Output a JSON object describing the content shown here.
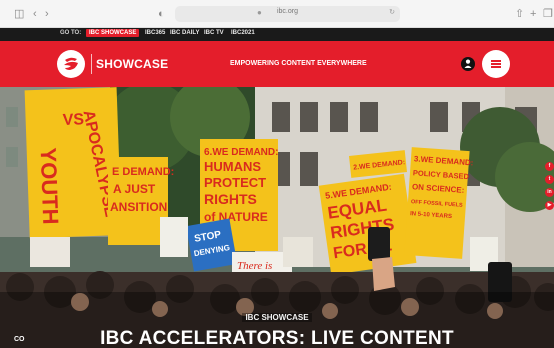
{
  "browser": {
    "url": "ibc.org"
  },
  "goto": {
    "label": "GO TO:",
    "links": [
      "IBC SHOWCASE",
      "IBC365",
      "IBC DAILY",
      "IBC TV",
      "IBC2021"
    ]
  },
  "header": {
    "brand": "SHOWCASE",
    "tagline": "EMPOWERING CONTENT EVERYWHERE"
  },
  "hero": {
    "kicker": "IBC SHOWCASE",
    "headline": "IBC ACCELERATORS: LIVE CONTENT",
    "cc_label": "CO"
  },
  "signs": {
    "youth": "YOUTH",
    "vs": "VS",
    "apocalypse": "APOCALYPSE",
    "transition_1": "E DEMAND:",
    "transition_2": "A JUST",
    "transition_3": "ANSITION",
    "humans_1": "6.WE DEMAND:",
    "humans_2": "HUMANS",
    "humans_3": "PROTECT",
    "humans_4": "RIGHTS",
    "humans_5": "of NATURE",
    "equal_1": "5.WE DEMAND:",
    "equal_2": "EQUAL",
    "equal_3": "RIGHTS",
    "equal_4": "FOR AL",
    "policy_1": "3.WE DEMAND:",
    "policy_2": "POLICY BASED",
    "policy_3": "ON SCIENCE:",
    "policy_4": "OFF FOSSIL FUELS",
    "policy_5": "IN 5-10 YEARS",
    "stop_1": "STOP",
    "stop_2": "DENYING",
    "there_is": "There is",
    "mid_1": "2.WE DEMAND:"
  },
  "colors": {
    "brand_red": "#e41e2b",
    "sign_yellow": "#f4c21b"
  },
  "social_icons": [
    "facebook-icon",
    "twitter-icon",
    "linkedin-icon",
    "youtube-icon"
  ]
}
